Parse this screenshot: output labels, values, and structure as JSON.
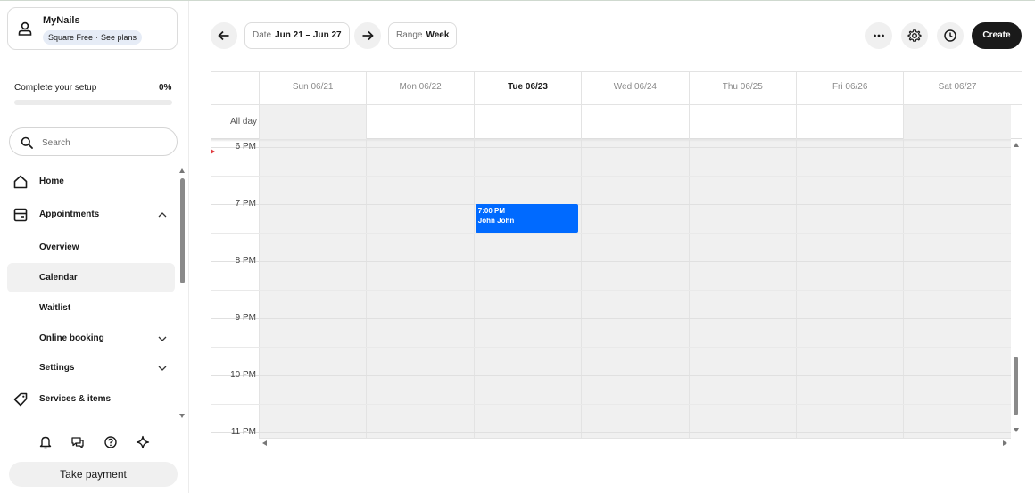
{
  "business": {
    "name": "MyNails",
    "plan": "Square Free",
    "plan_separator": "·",
    "see_plans": "See plans",
    "avatar_icon": "person-icon"
  },
  "setup": {
    "title": "Complete your setup",
    "percent": "0%",
    "progress": 0
  },
  "search": {
    "placeholder": "Search",
    "value": ""
  },
  "nav": {
    "home": "Home",
    "appointments": "Appointments",
    "overview": "Overview",
    "calendar": "Calendar",
    "waitlist": "Waitlist",
    "online_booking": "Online booking",
    "settings": "Settings",
    "services_items": "Services & items",
    "selected": "Calendar"
  },
  "bottom_icons": [
    "bell-icon",
    "chat-icon",
    "help-icon",
    "sparkle-icon"
  ],
  "take_payment": "Take payment",
  "toolbar": {
    "date_label": "Date",
    "date_value": "Jun 21 – Jun 27",
    "range_label": "Range",
    "range_value": "Week",
    "create": "Create",
    "more_icon": "more-horizontal-icon",
    "settings_icon": "gear-icon",
    "history_icon": "clock-icon"
  },
  "calendar": {
    "days": [
      "Sun 06/21",
      "Mon 06/22",
      "Tue 06/23",
      "Wed 06/24",
      "Thu 06/25",
      "Fri 06/26",
      "Sat 06/27"
    ],
    "today_index": 2,
    "all_day": "All day",
    "hours": [
      "6 PM",
      "7 PM",
      "8 PM",
      "9 PM",
      "10 PM",
      "11 PM"
    ],
    "appointment": {
      "time": "7:00 PM",
      "client": "John John",
      "day_index": 2
    }
  },
  "colors": {
    "accent": "#006aff",
    "now_line": "#e0393e",
    "create_bg": "#1a1a1a"
  }
}
